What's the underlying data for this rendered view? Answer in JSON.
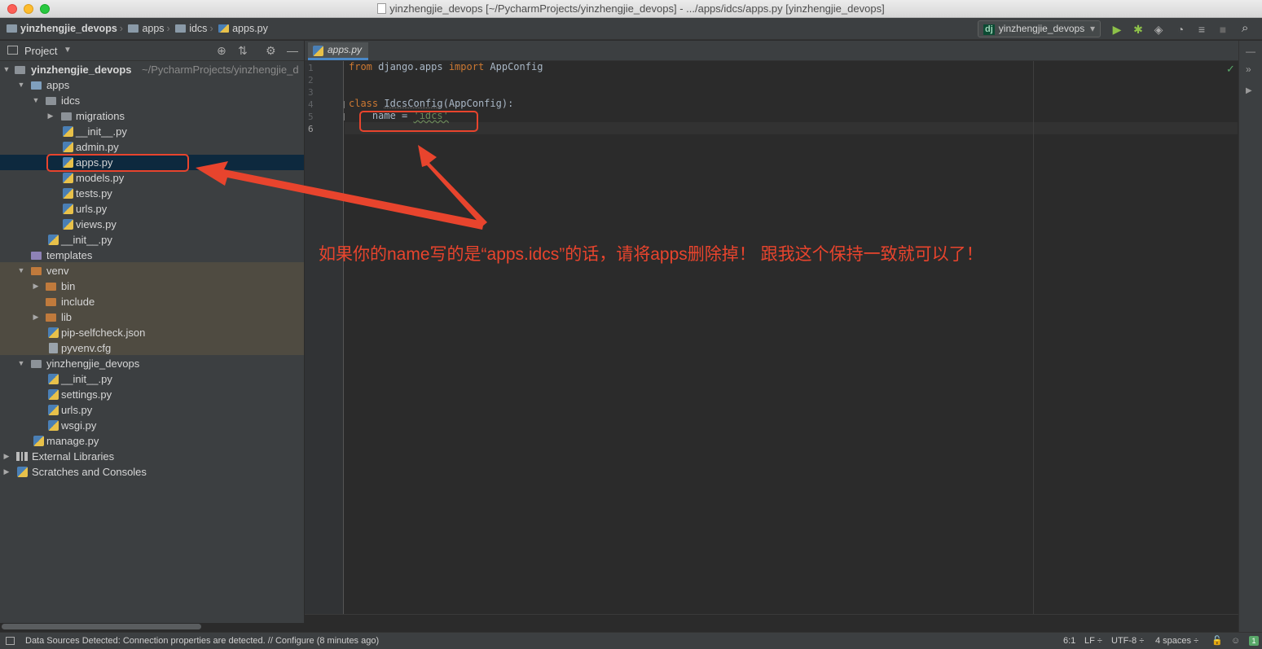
{
  "window": {
    "title": "yinzhengjie_devops [~/PycharmProjects/yinzhengjie_devops] - .../apps/idcs/apps.py [yinzhengjie_devops]"
  },
  "breadcrumb": [
    "yinzhengjie_devops",
    "apps",
    "idcs",
    "apps.py"
  ],
  "toolbar": {
    "run_config": "yinzhengjie_devops",
    "run_config_badge": "dj"
  },
  "project_panel": {
    "title": "Project",
    "root_name": "yinzhengjie_devops",
    "root_path": "~/PycharmProjects/yinzhengjie_d",
    "items": [
      {
        "label": "apps"
      },
      {
        "label": "idcs"
      },
      {
        "label": "migrations"
      },
      {
        "label": "__init__.py"
      },
      {
        "label": "admin.py"
      },
      {
        "label": "apps.py"
      },
      {
        "label": "models.py"
      },
      {
        "label": "tests.py"
      },
      {
        "label": "urls.py"
      },
      {
        "label": "views.py"
      },
      {
        "label": "__init__.py"
      },
      {
        "label": "templates"
      },
      {
        "label": "venv"
      },
      {
        "label": "bin"
      },
      {
        "label": "include"
      },
      {
        "label": "lib"
      },
      {
        "label": "pip-selfcheck.json"
      },
      {
        "label": "pyvenv.cfg"
      },
      {
        "label": "yinzhengjie_devops"
      },
      {
        "label": "__init__.py"
      },
      {
        "label": "settings.py"
      },
      {
        "label": "urls.py"
      },
      {
        "label": "wsgi.py"
      },
      {
        "label": "manage.py"
      },
      {
        "label": "External Libraries"
      },
      {
        "label": "Scratches and Consoles"
      }
    ]
  },
  "editor": {
    "tab_label": "apps.py",
    "line_numbers": [
      "1",
      "2",
      "3",
      "4",
      "5",
      "6"
    ],
    "code": {
      "l1_kw1": "from",
      "l1_mod": " django.apps ",
      "l1_kw2": "import",
      "l1_name": " AppConfig",
      "l4_kw": "class",
      "l4_cls": "IdcsConfig",
      "l4_rest": "(AppConfig):",
      "l5_pre": "    name = ",
      "l5_str": "'idcs'"
    }
  },
  "annotation": {
    "text": "如果你的name写的是“apps.idcs”的话，请将apps删除掉！ 跟我这个保持一致就可以了！",
    "color": "#e8442d"
  },
  "status_bar": {
    "message": "Data Sources Detected: Connection properties are detected. // Configure (8 minutes ago)",
    "position": "6:1",
    "line_sep": "LF ÷",
    "encoding": "UTF-8 ÷",
    "indent": "4 spaces ÷"
  },
  "colors": {
    "accent": "#4a88c7",
    "selection": "#0d293e",
    "annotation_red": "#e8442d"
  }
}
